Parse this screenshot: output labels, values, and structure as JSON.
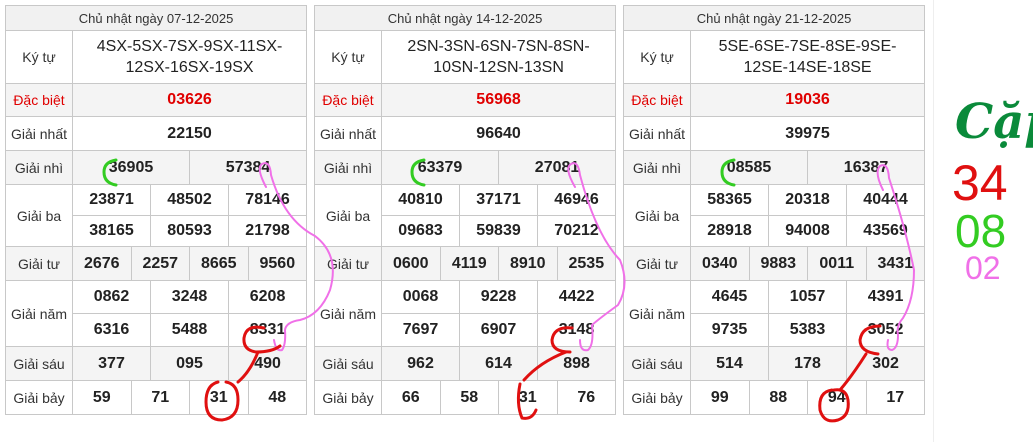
{
  "tables": [
    {
      "date": "Chủ nhật ngày 07-12-2025",
      "ky_tu_label": "Ký tự",
      "ky_tu": [
        "4SX-5SX-7SX-9SX-11SX-",
        "12SX-16SX-19SX"
      ],
      "dac_biet_label": "Đặc biệt",
      "dac_biet": "03626",
      "nhat_label": "Giải nhất",
      "nhat": "22150",
      "nhi_label": "Giải nhì",
      "nhi": [
        "36905",
        "57384"
      ],
      "ba_label": "Giải ba",
      "ba": [
        "23871",
        "48502",
        "78146",
        "38165",
        "80593",
        "21798"
      ],
      "tu_label": "Giải tư",
      "tu": [
        "2676",
        "2257",
        "8665",
        "9560"
      ],
      "nam_label": "Giải năm",
      "nam": [
        "0862",
        "3248",
        "6208",
        "6316",
        "5488",
        "8331"
      ],
      "sau_label": "Giải sáu",
      "sau": [
        "377",
        "095",
        "490"
      ],
      "bay_label": "Giải bảy",
      "bay": [
        "59",
        "71",
        "31",
        "48"
      ]
    },
    {
      "date": "Chủ nhật ngày 14-12-2025",
      "ky_tu_label": "Ký tự",
      "ky_tu": [
        "2SN-3SN-6SN-7SN-8SN-",
        "10SN-12SN-13SN"
      ],
      "dac_biet_label": "Đặc biệt",
      "dac_biet": "56968",
      "nhat_label": "Giải nhất",
      "nhat": "96640",
      "nhi_label": "Giải nhì",
      "nhi": [
        "63379",
        "27081"
      ],
      "ba_label": "Giải ba",
      "ba": [
        "40810",
        "37171",
        "46946",
        "09683",
        "59839",
        "70212"
      ],
      "tu_label": "Giải tư",
      "tu": [
        "0600",
        "4119",
        "8910",
        "2535"
      ],
      "nam_label": "Giải năm",
      "nam": [
        "0068",
        "9228",
        "4422",
        "7697",
        "6907",
        "3148"
      ],
      "sau_label": "Giải sáu",
      "sau": [
        "962",
        "614",
        "898"
      ],
      "bay_label": "Giải bảy",
      "bay": [
        "66",
        "58",
        "31",
        "76"
      ]
    },
    {
      "date": "Chủ nhật ngày 21-12-2025",
      "ky_tu_label": "Ký tự",
      "ky_tu": [
        "5SE-6SE-7SE-8SE-9SE-",
        "12SE-14SE-18SE"
      ],
      "dac_biet_label": "Đặc biệt",
      "dac_biet": "19036",
      "nhat_label": "Giải nhất",
      "nhat": "39975",
      "nhi_label": "Giải nhì",
      "nhi": [
        "08585",
        "16387"
      ],
      "ba_label": "Giải ba",
      "ba": [
        "58365",
        "20318",
        "40444",
        "28918",
        "94008",
        "43569"
      ],
      "tu_label": "Giải tư",
      "tu": [
        "0340",
        "9883",
        "0011",
        "3431"
      ],
      "nam_label": "Giải năm",
      "nam": [
        "4645",
        "1057",
        "4391",
        "9735",
        "5383",
        "3052"
      ],
      "sau_label": "Giải sáu",
      "sau": [
        "514",
        "178",
        "302"
      ],
      "bay_label": "Giải bảy",
      "bay": [
        "99",
        "88",
        "94",
        "17"
      ]
    }
  ],
  "notes": {
    "title": "Cặp",
    "lines": [
      "34",
      "08",
      "02"
    ]
  },
  "colors": {
    "title_note": "#0a8a3a",
    "note_red": "#e01010",
    "note_green": "#33cc22",
    "note_pink": "#f070e8",
    "special_red": "#e00000"
  }
}
